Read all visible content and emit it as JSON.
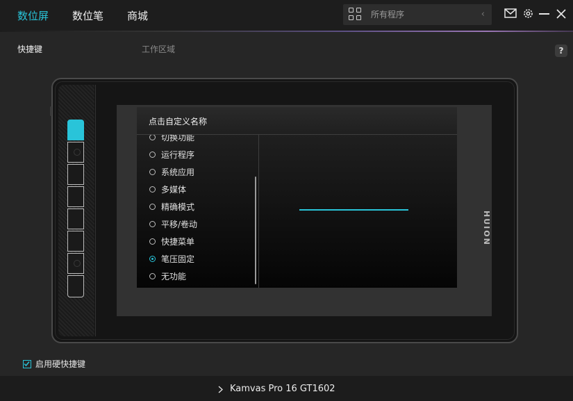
{
  "nav": {
    "tabs": [
      "数位屏",
      "数位笔",
      "商城"
    ],
    "active": 0
  },
  "search": {
    "placeholder": "所有程序"
  },
  "icons": [
    "grid-icon",
    "chevron-left-icon",
    "mail-icon",
    "gear-icon",
    "minimize-icon",
    "close-icon",
    "help-icon"
  ],
  "subheader": {
    "tab_hotkeys": "快捷键",
    "tab_workarea": "工作区域",
    "help": "?"
  },
  "tablet": {
    "brand": "HUION",
    "hotkey_count": 8,
    "selected_key": 1
  },
  "popup": {
    "title": "点击自定义名称",
    "options": [
      "切换功能",
      "运行程序",
      "系统应用",
      "多媒体",
      "精确模式",
      "平移/卷动",
      "快捷菜单",
      "笔压固定",
      "无功能"
    ],
    "selected": "笔压固定"
  },
  "enable_hotkeys": {
    "label": "启用硬快捷键",
    "checked": true
  },
  "footer": {
    "device": "Kamvas Pro 16 GT1602"
  },
  "colors": {
    "accent": "#29c4d9",
    "background": "#262626",
    "topbar": "#1d1d1d"
  }
}
